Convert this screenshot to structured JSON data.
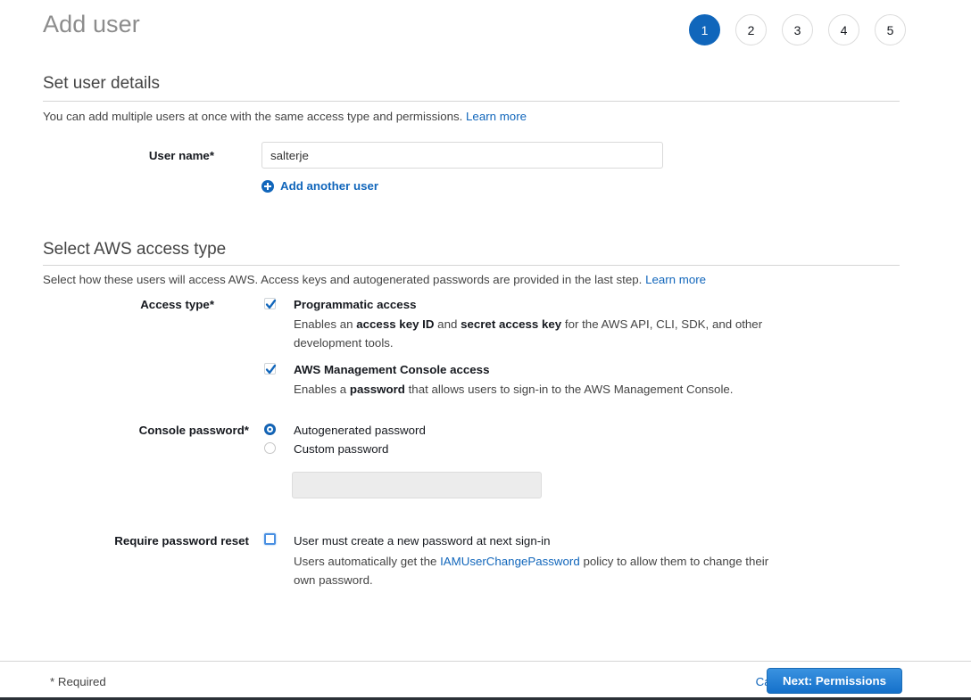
{
  "header": {
    "title": "Add user",
    "steps": [
      {
        "number": "1",
        "active": true
      },
      {
        "number": "2",
        "active": false
      },
      {
        "number": "3",
        "active": false
      },
      {
        "number": "4",
        "active": false
      },
      {
        "number": "5",
        "active": false
      }
    ]
  },
  "colors": {
    "accent_blue": "#1066bb",
    "link_blue": "#1166bb",
    "button_blue": "#1470ca",
    "title_gray": "#8c8c8c",
    "text": "#16191f",
    "rule": "#d5d5d5",
    "disabled_field": "#ececec"
  },
  "user_details": {
    "section_title": "Set user details",
    "description": "You can add multiple users at once with the same access type and permissions.",
    "learn_more": "Learn more",
    "username_label": "User name*",
    "username_value": "salterje",
    "username_placeholder": "",
    "add_another_user": "Add another user",
    "plus_icon": "plus-circle-icon"
  },
  "access_type": {
    "section_title": "Select AWS access type",
    "description": "Select how these users will access AWS. Access keys and autogenerated passwords are provided in the last step.",
    "learn_more": "Learn more",
    "label": "Access type*",
    "options": [
      {
        "title": "Programmatic access",
        "checked": true,
        "desc_part1": "Enables an ",
        "desc_bold1": "access key ID",
        "desc_part2": " and ",
        "desc_bold2": "secret access key",
        "desc_part3": " for the AWS API, CLI, SDK, and other development tools."
      },
      {
        "title": "AWS Management Console access",
        "checked": true,
        "desc_part1": "Enables a ",
        "desc_bold1": "password",
        "desc_part2": " that allows users to sign-in to the AWS Management Console.",
        "desc_bold2": "",
        "desc_part3": ""
      }
    ]
  },
  "console_password": {
    "label": "Console password*",
    "options": [
      {
        "label": "Autogenerated password",
        "selected": true
      },
      {
        "label": "Custom password",
        "selected": false
      }
    ],
    "custom_password_value": "",
    "custom_password_placeholder": "",
    "custom_password_disabled": true
  },
  "password_reset": {
    "label": "Require password reset",
    "checked": false,
    "focused": true,
    "option_title": "User must create a new password at next sign-in",
    "desc_part1": "Users automatically get the ",
    "policy_link": "IAMUserChangePassword",
    "desc_part2": " policy to allow them to change their own password."
  },
  "footer": {
    "required_note": "* Required",
    "cancel_label": "Cancel",
    "next_label": "Next: Permissions"
  }
}
